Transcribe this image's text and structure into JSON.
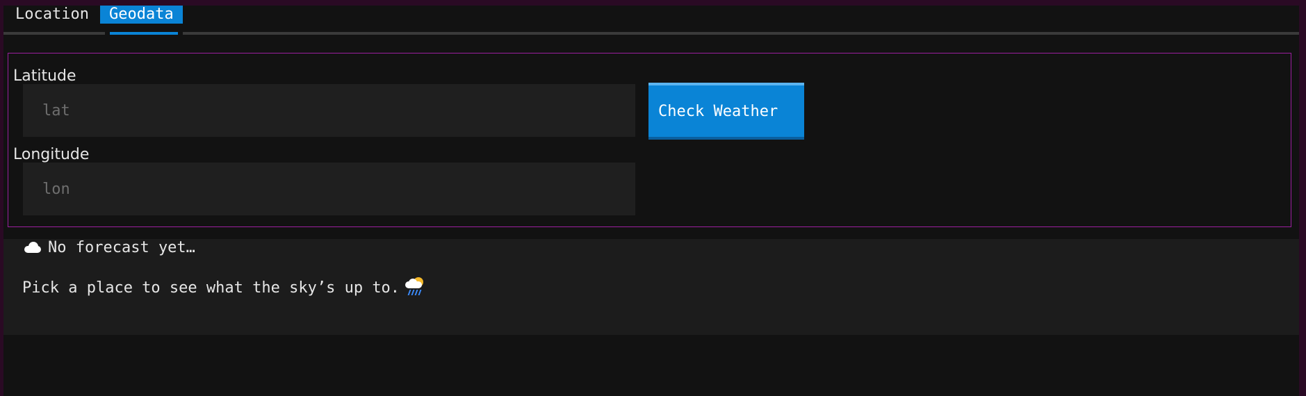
{
  "tabs": [
    {
      "label": "Location",
      "active": false
    },
    {
      "label": "Geodata",
      "active": true
    }
  ],
  "form": {
    "latitude_label": "Latitude",
    "latitude_placeholder": "lat",
    "latitude_value": "",
    "longitude_label": "Longitude",
    "longitude_placeholder": "lon",
    "longitude_value": "",
    "check_button_label": "Check Weather"
  },
  "forecast": {
    "title": "No forecast yet…",
    "title_icon": "cloud-icon",
    "message": "Pick a place to see what the sky’s up to.",
    "message_icon": "sun-rain-cloud-icon"
  },
  "colors": {
    "accent": "#0a84d6",
    "panel_border": "#9c1fa0",
    "background": "#121212"
  }
}
